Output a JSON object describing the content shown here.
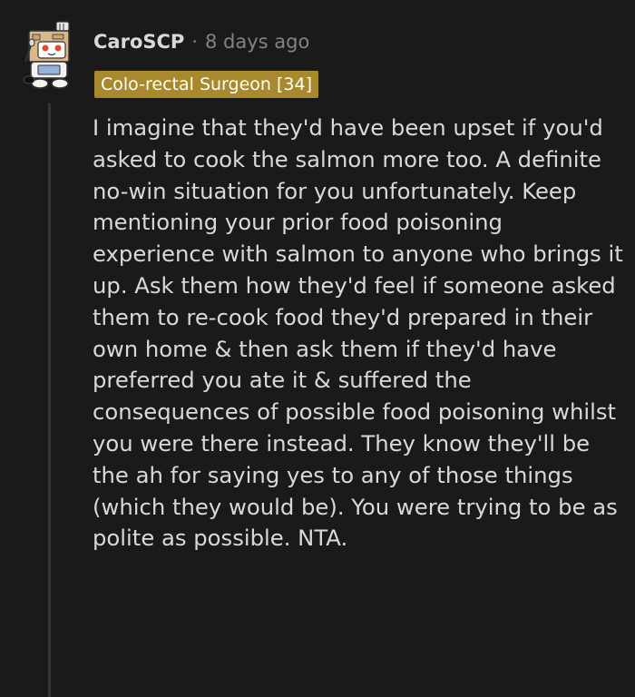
{
  "comment": {
    "author": "CaroSCP",
    "separator": "·",
    "timestamp": "8 days ago",
    "flair": "Colo-rectal Surgeon [34]",
    "body": "I imagine that they'd have been upset if you'd asked to cook the salmon more too. A definite no-win situation for you unfortunately. Keep mentioning your prior food poisoning experience with salmon to anyone who brings it up. Ask them how they'd feel if someone asked them to re-cook food they'd prepared in their own home & then ask them if they'd have preferred you ate it & suffered the consequences of possible food poisoning whilst you were there instead. They know they'll be the ah for saying yes to any of those things (which they would be). You were trying to be as polite as possible. NTA.",
    "avatar_icon": "snoo-avatar-icon"
  },
  "colors": {
    "background": "#1a1a1b",
    "text": "#d7dadc",
    "meta": "#818384",
    "flair_bg": "#a8892c",
    "thread_line": "#343536"
  }
}
